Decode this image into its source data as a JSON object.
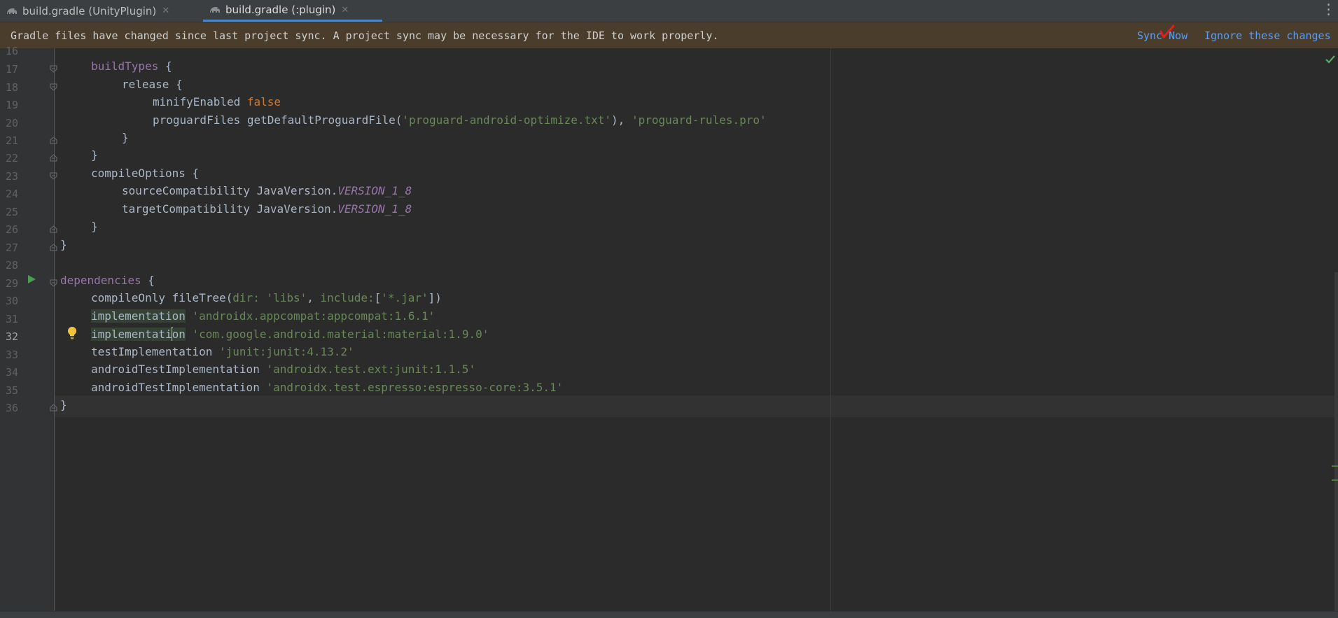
{
  "tabs": [
    {
      "label": "build.gradle (UnityPlugin)",
      "active": false
    },
    {
      "label": "build.gradle (:plugin)",
      "active": true
    }
  ],
  "banner": {
    "message": "Gradle files have changed since last project sync. A project sync may be necessary for the IDE to work properly.",
    "sync_now": "Sync Now",
    "ignore": "Ignore these changes"
  },
  "colors": {
    "accent": "#4a88c7",
    "link": "#589df6",
    "banner_bg": "#4a3d2c",
    "editor_bg": "#2b2b2b"
  },
  "editor": {
    "current_line": "32",
    "line_numbers": [
      "16",
      "17",
      "18",
      "19",
      "20",
      "21",
      "22",
      "23",
      "24",
      "25",
      "26",
      "27",
      "28",
      "29",
      "30",
      "31",
      "32",
      "33",
      "34",
      "35",
      "36"
    ],
    "lines": {
      "l17": {
        "kw": "buildTypes",
        "rest": " {"
      },
      "l18": {
        "text": "release {"
      },
      "l19": {
        "a": "minifyEnabled ",
        "b": "false"
      },
      "l20": {
        "a": "proguardFiles getDefaultProguardFile(",
        "b": "'proguard-android-optimize.txt'",
        "c": "), ",
        "d": "'proguard-rules.pro'"
      },
      "l21": {
        "text": "}"
      },
      "l22": {
        "text": "}"
      },
      "l23": {
        "text": "compileOptions {"
      },
      "l24": {
        "a": "sourceCompatibility JavaVersion.",
        "b": "VERSION_1_8"
      },
      "l25": {
        "a": "targetCompatibility JavaVersion.",
        "b": "VERSION_1_8"
      },
      "l26": {
        "text": "}"
      },
      "l27": {
        "text": "}"
      },
      "l29": {
        "kw": "dependencies",
        "rest": " {"
      },
      "l30": {
        "a": "compileOnly fileTree(",
        "b": "dir: ",
        "c": "'libs'",
        "d": ", ",
        "e": "include:",
        "f": "[",
        "g": "'*.jar'",
        "h": "])"
      },
      "l31": {
        "a": "implementation",
        "b": " ",
        "c": "'androidx.appcompat:appcompat:1.6.1'"
      },
      "l32": {
        "a1": "implementati",
        "a2": "on",
        "b": " ",
        "c": "'com.google.android.material:material:1.9.0'"
      },
      "l33": {
        "a": "testImplementation ",
        "b": "'junit:junit:4.13.2'"
      },
      "l34": {
        "a": "androidTestImplementation ",
        "b": "'androidx.test.ext:junit:1.1.5'"
      },
      "l35": {
        "a": "androidTestImplementation ",
        "b": "'androidx.test.espresso:espresso-core:3.5.1'"
      },
      "l36": {
        "text": "}"
      }
    }
  }
}
